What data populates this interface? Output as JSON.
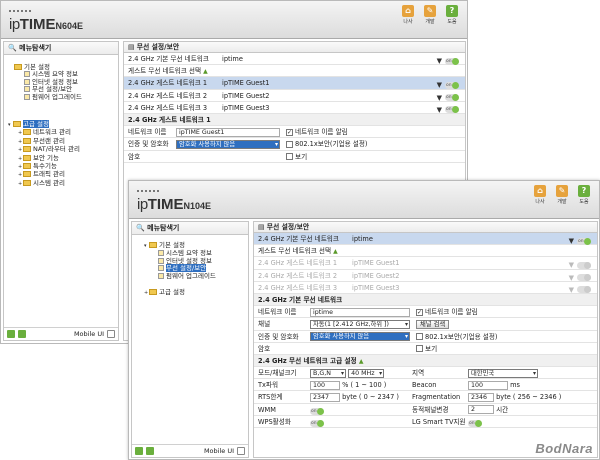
{
  "w1": {
    "model": "N604E",
    "header_icons": [
      "나사",
      "개발",
      "도움"
    ],
    "sidebar": {
      "title": "메뉴탐색기",
      "basic": "기본 설정",
      "basic_items": [
        "시스템 요약 정보",
        "인터넷 설정 정보",
        "무선 설정/보안",
        "펌웨어 업그레이드"
      ],
      "adv": "고급 설정",
      "adv_items": [
        "네트워크 관리",
        "무선랜 관리",
        "NAT/라우터 관리",
        "보안 기능",
        "특수기능",
        "트래픽 관리",
        "시스템 관리"
      ],
      "footer": "Mobile UI"
    },
    "main": {
      "title": "무선 설정/보안",
      "rows": [
        {
          "label": "2.4 GHz 기본 무선 네트워크",
          "value": "iptime",
          "toggle": "on"
        },
        {
          "label": "게스트 무선 네트워크 선택",
          "value": "",
          "toggle": ""
        },
        {
          "label": "2.4 GHz 게스트 네트워크 1",
          "value": "ipTIME Guest1",
          "toggle": "on"
        },
        {
          "label": "2.4 GHz 게스트 네트워크 2",
          "value": "ipTIME Guest2",
          "toggle": "on"
        },
        {
          "label": "2.4 GHz 게스트 네트워크 3",
          "value": "ipTIME Guest3",
          "toggle": "on"
        }
      ],
      "section": "2.4 GHz 게스트 네트워크 1",
      "name_label": "네트워크 이름",
      "name_value": "ipTIME Guest1",
      "broadcast": "네트워크 이름 알림",
      "auth_label": "인증 및 암호화",
      "auth_value": "암호화 사용하지 않음",
      "dot1x": "802.1x보안(기업용 설정)",
      "pw_label": "암호",
      "view": "보기"
    }
  },
  "w2": {
    "model": "N104E",
    "header_icons": [
      "나사",
      "개발",
      "도움"
    ],
    "sidebar": {
      "title": "메뉴탐색기",
      "basic": "기본 설정",
      "basic_items": [
        "시스템 요약 정보",
        "인터넷 설정 정보",
        "무선 설정/보안",
        "펌웨어 업그레이드"
      ],
      "adv": "고급 설정",
      "footer": "Mobile UI"
    },
    "main": {
      "title": "무선 설정/보안",
      "rows": [
        {
          "label": "2.4 GHz 기본 무선 네트워크",
          "value": "iptime",
          "toggle": "on"
        },
        {
          "label": "게스트 무선 네트워크 선택",
          "value": "",
          "toggle": ""
        },
        {
          "label": "2.4 GHz 게스트 네트워크 1",
          "value": "ipTIME Guest1",
          "toggle": "off"
        },
        {
          "label": "2.4 GHz 게스트 네트워크 2",
          "value": "ipTIME Guest2",
          "toggle": "off"
        },
        {
          "label": "2.4 GHz 게스트 네트워크 3",
          "value": "ipTIME Guest3",
          "toggle": "off"
        }
      ],
      "section": "2.4 GHz 기본 무선 네트워크",
      "name_label": "네트워크 이름",
      "name_value": "iptime",
      "broadcast": "네트워크 이름 알림",
      "ch_label": "채널",
      "ch_value": "자동(1 [2.412 GHz,하위 ])",
      "ch_btn": "채널 검색",
      "auth_label": "인증 및 암호화",
      "auth_value": "암호화 사용하지 않음",
      "dot1x": "802.1x보안(기업용 설정)",
      "pw_label": "암호",
      "view": "보기",
      "adv_section": "2.4 GHz 무선 네트워크 고급 설정",
      "mode_label": "모드/채널크기",
      "mode_value": "B,G,N",
      "bw_value": "40 MHz",
      "region_label": "지역",
      "region_value": "대한민국",
      "tx_label": "Tx파워",
      "tx_value": "100",
      "tx_unit": "% ( 1 ~ 100 )",
      "beacon_label": "Beacon",
      "beacon_value": "100",
      "beacon_unit": "ms",
      "rts_label": "RTS한계",
      "rts_value": "2347",
      "rts_unit": "byte ( 0 ~ 2347 )",
      "frag_label": "Fragmentation",
      "frag_value": "2346",
      "frag_unit": "byte ( 256 ~ 2346 )",
      "wmm_label": "WMM",
      "dyn_label": "동적채널변경",
      "dyn_value": "2",
      "dyn_unit": "시간",
      "wps_label": "WPS활성화",
      "lg_label": "LG Smart TV지원"
    }
  },
  "toggle_on": "on",
  "watermark": "BodNara"
}
